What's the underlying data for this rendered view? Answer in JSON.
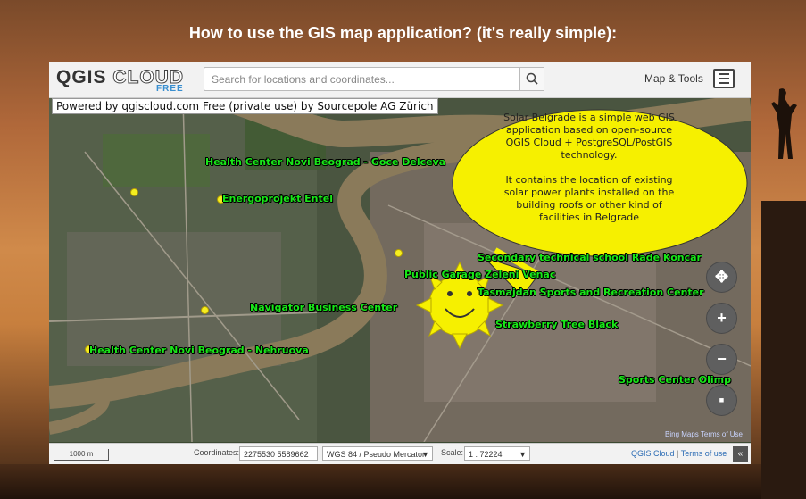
{
  "page": {
    "title": "How to use the GIS map application? (it's really simple):"
  },
  "app": {
    "logo_main": "QGIS",
    "logo_cloud": "CLOUD",
    "logo_free": "FREE",
    "search_placeholder": "Search for locations and coordinates...",
    "map_tools_label": "Map & Tools",
    "powered_by": "Powered by qgiscloud.com Free (private use) by Sourcepole AG Zürich",
    "bubble": {
      "para1": "Solar Belgrade is a simple web GIS application based on open-source QGIS Cloud + PostgreSQL/PostGIS technology.",
      "para2": "It contains the location of existing solar power plants installed on the building roofs or other kind of facilities in Belgrade"
    },
    "labels": [
      "Health Center Novi Beograd - Goce Delceva",
      "Energoprojekt Entel",
      "Navigator Business Center",
      "Health Center Novi Beograd - Nehruova",
      "Public Garage Zeleni Venac",
      "Secondary technical school Rade Koncar",
      "Tasmajdan Sports and Recreation Center",
      "Strawberry Tree Black",
      "Sports Center Olimp"
    ],
    "controls": {
      "pan": "✥",
      "zoom_in": "+",
      "zoom_out": "−",
      "layers": "▪"
    },
    "bing": "Bing Maps Terms of Use",
    "bottom": {
      "scale_bar": "1000 m",
      "coordinates_label": "Coordinates:",
      "coordinates_value": "2275530 5589662",
      "crs": "WGS 84 / Pseudo Mercator",
      "scale_label": "Scale:",
      "scale_value": "1 : 72224",
      "link_cloud": "QGIS Cloud",
      "separator": "|",
      "link_terms": "Terms of use",
      "collapse": "«"
    }
  }
}
